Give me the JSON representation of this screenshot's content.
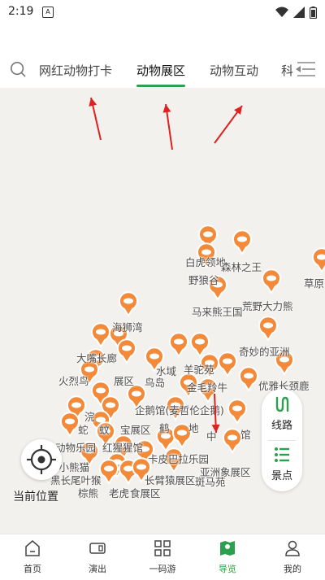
{
  "status_bar": {
    "time": "2:19",
    "notification_icon": "a-notification-icon",
    "wifi_icon": "wifi-icon",
    "signal_icon": "signal-icon",
    "battery_icon": "battery-icon"
  },
  "tabs": {
    "items": [
      {
        "label": "网红动物打卡",
        "active": false
      },
      {
        "label": "动物展区",
        "active": true
      },
      {
        "label": "动物互动",
        "active": false
      },
      {
        "label": "科",
        "active": false
      }
    ]
  },
  "map": {
    "labels": [
      "白虎领地",
      "森林之王",
      "野狼谷",
      "草原",
      "马来熊王国",
      "荒野大力熊",
      "海狮湾",
      "奇妙的亚洲",
      "大嘴长廊",
      "水域",
      "羊驼苑",
      "火烈鸟",
      "展区",
      "鸟岛",
      "金毛羚牛",
      "优雅长颈鹿",
      "企鹅馆(麦哲伦企鹅)",
      "浣",
      "蚊",
      "蛇",
      "宝展区",
      "鹤",
      "地",
      "中",
      "馆",
      "动物乐园",
      "红猩猩馆",
      "卡皮巴拉乐园",
      "州小熊猫",
      "亚洲象展区",
      "黑长尾叶猴",
      "长臂猿展区",
      "斑马苑",
      "棕熊",
      "老虎",
      "食展区"
    ]
  },
  "controls": {
    "locate_label": "当前位置",
    "route_label": "线路",
    "spots_label": "景点"
  },
  "nav": {
    "items": [
      {
        "label": "首页",
        "icon": "home-icon",
        "active": false
      },
      {
        "label": "演出",
        "icon": "ticket-icon",
        "active": false
      },
      {
        "label": "一码游",
        "icon": "grid-icon",
        "active": false
      },
      {
        "label": "导览",
        "icon": "map-guide-icon",
        "active": true
      },
      {
        "label": "我的",
        "icon": "user-icon",
        "active": false
      }
    ]
  },
  "colors": {
    "accent": "#2e9e4f",
    "marker": "#f28a3a",
    "arrow": "#e02020",
    "map_bg": "#f3f1ed"
  }
}
